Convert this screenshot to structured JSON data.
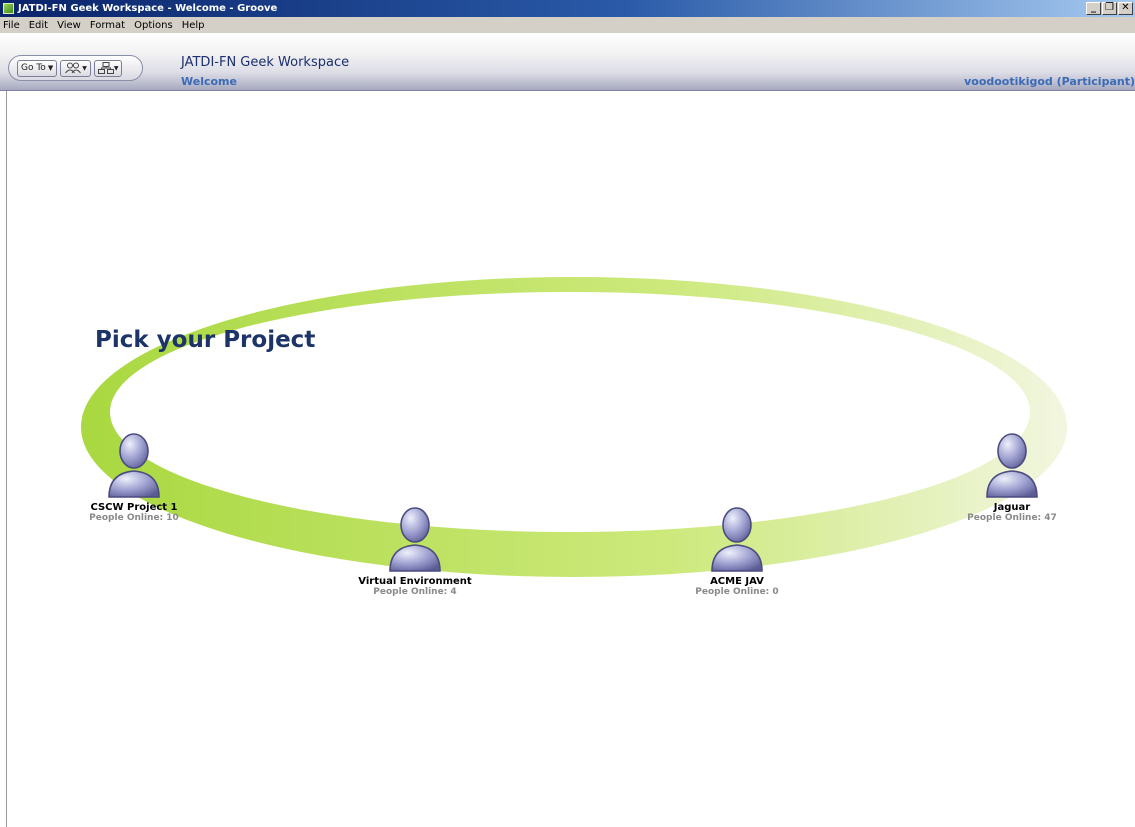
{
  "window": {
    "title": "JATDI-FN Geek Workspace - Welcome - Groove",
    "app_icon": "groove-app-icon",
    "controls": [
      "minimize-icon",
      "restore-icon",
      "close-icon"
    ]
  },
  "menu": {
    "file": "File",
    "edit": "Edit",
    "view": "View",
    "format": "Format",
    "options": "Options",
    "help": "Help"
  },
  "toolbar": {
    "goto_label": "Go To",
    "people_icon": "people-icon",
    "workspace_icon": "workspace-tree-icon"
  },
  "workspace": {
    "title": "JATDI-FN Geek Workspace",
    "subtitle": "Welcome",
    "user": "voodootikigod (Participant)"
  },
  "main": {
    "heading": "Pick your Project",
    "ring_colors": [
      "#a9d840",
      "#f2f6e0"
    ],
    "projects": [
      {
        "name": "CSCW Project 1",
        "online": "People Online: 10",
        "icon": "person-icon"
      },
      {
        "name": "Virtual Environment",
        "online": "People Online: 4",
        "icon": "person-icon"
      },
      {
        "name": "ACME JAV",
        "online": "People Online: 0",
        "icon": "person-icon"
      },
      {
        "name": "Jaguar",
        "online": "People Online: 47",
        "icon": "person-icon"
      }
    ]
  },
  "colors": {
    "titlebar": "#0a246a",
    "heading": "#1c3468",
    "link": "#3b6bb6",
    "person_icon": "#7f7fb6"
  }
}
